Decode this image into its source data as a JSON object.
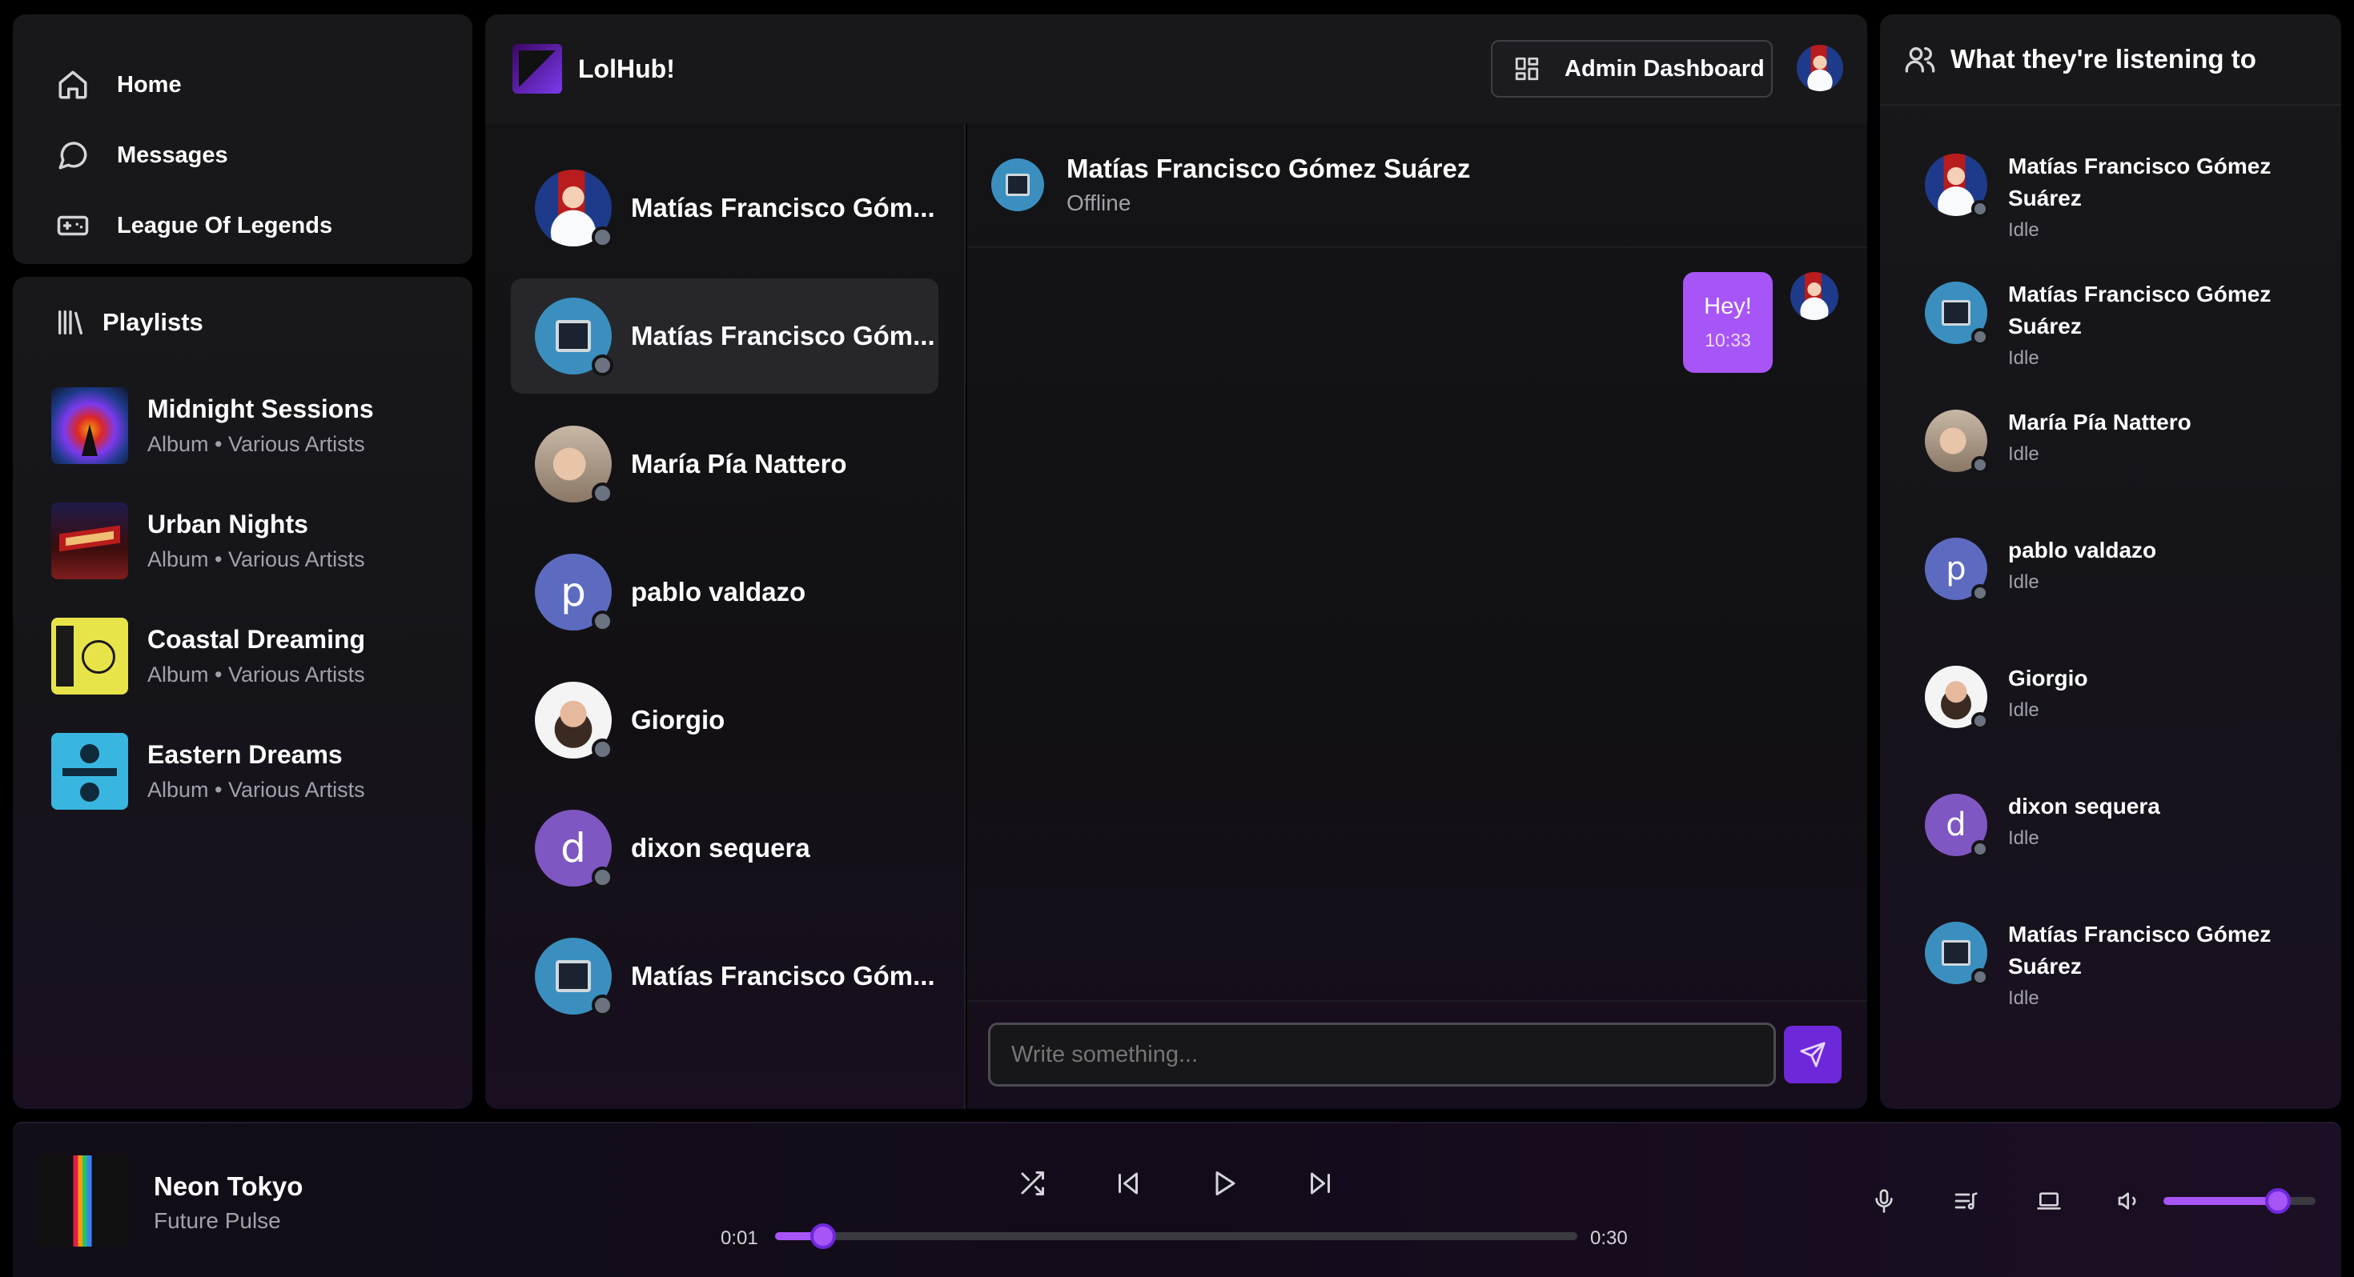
{
  "nav": {
    "items": [
      {
        "label": "Home",
        "icon": "home-icon"
      },
      {
        "label": "Messages",
        "icon": "message-circle-icon"
      },
      {
        "label": "League Of Legends",
        "icon": "gamepad-icon"
      }
    ]
  },
  "playlists": {
    "title": "Playlists",
    "items": [
      {
        "title": "Midnight Sessions",
        "type": "Album",
        "artist": "Various Artists"
      },
      {
        "title": "Urban Nights",
        "type": "Album",
        "artist": "Various Artists"
      },
      {
        "title": "Coastal Dreaming",
        "type": "Album",
        "artist": "Various Artists"
      },
      {
        "title": "Eastern Dreams",
        "type": "Album",
        "artist": "Various Artists"
      }
    ],
    "separator": "•"
  },
  "header": {
    "app_name": "LolHub!",
    "admin_button": "Admin Dashboard"
  },
  "chats": [
    {
      "name": "Matías Francisco Góm...",
      "avatar": "photo-flags"
    },
    {
      "name": "Matías Francisco Góm...",
      "avatar": "retro-computer"
    },
    {
      "name": "María Pía Nattero",
      "avatar": "photo-woman"
    },
    {
      "name": "pablo valdazo",
      "avatar": "letter",
      "letter": "p",
      "color": "#5c6bc0"
    },
    {
      "name": "Giorgio",
      "avatar": "photo-man"
    },
    {
      "name": "dixon sequera",
      "avatar": "letter",
      "letter": "d",
      "color": "#7e57c2"
    },
    {
      "name": "Matías Francisco Góm...",
      "avatar": "retro-computer"
    }
  ],
  "conversation": {
    "name": "Matías Francisco Gómez Suárez",
    "status": "Offline",
    "messages": [
      {
        "text": "Hey!",
        "time": "10:33"
      }
    ],
    "input_placeholder": "Write something..."
  },
  "friends": {
    "title": "What they're listening to",
    "items": [
      {
        "name": "Matías Francisco Gómez Suárez",
        "status": "Idle",
        "avatar": "photo-flags"
      },
      {
        "name": "Matías Francisco Gómez Suárez",
        "status": "Idle",
        "avatar": "retro-computer"
      },
      {
        "name": "María Pía Nattero",
        "status": "Idle",
        "avatar": "photo-woman"
      },
      {
        "name": "pablo valdazo",
        "status": "Idle",
        "avatar": "letter",
        "letter": "p",
        "color": "#5c6bc0"
      },
      {
        "name": "Giorgio",
        "status": "Idle",
        "avatar": "photo-man"
      },
      {
        "name": "dixon sequera",
        "status": "Idle",
        "avatar": "letter",
        "letter": "d",
        "color": "#7e57c2"
      },
      {
        "name": "Matías Francisco Gómez Suárez",
        "status": "Idle",
        "avatar": "retro-computer"
      }
    ]
  },
  "player": {
    "title": "Neon Tokyo",
    "artist": "Future Pulse",
    "current_time": "0:01",
    "duration": "0:30",
    "progress": 0.06,
    "volume": 0.75
  },
  "colors": {
    "accent": "#a855f7",
    "accent_dark": "#6d28d9",
    "panel": "#18181b",
    "status_offline": "#6b7280"
  }
}
